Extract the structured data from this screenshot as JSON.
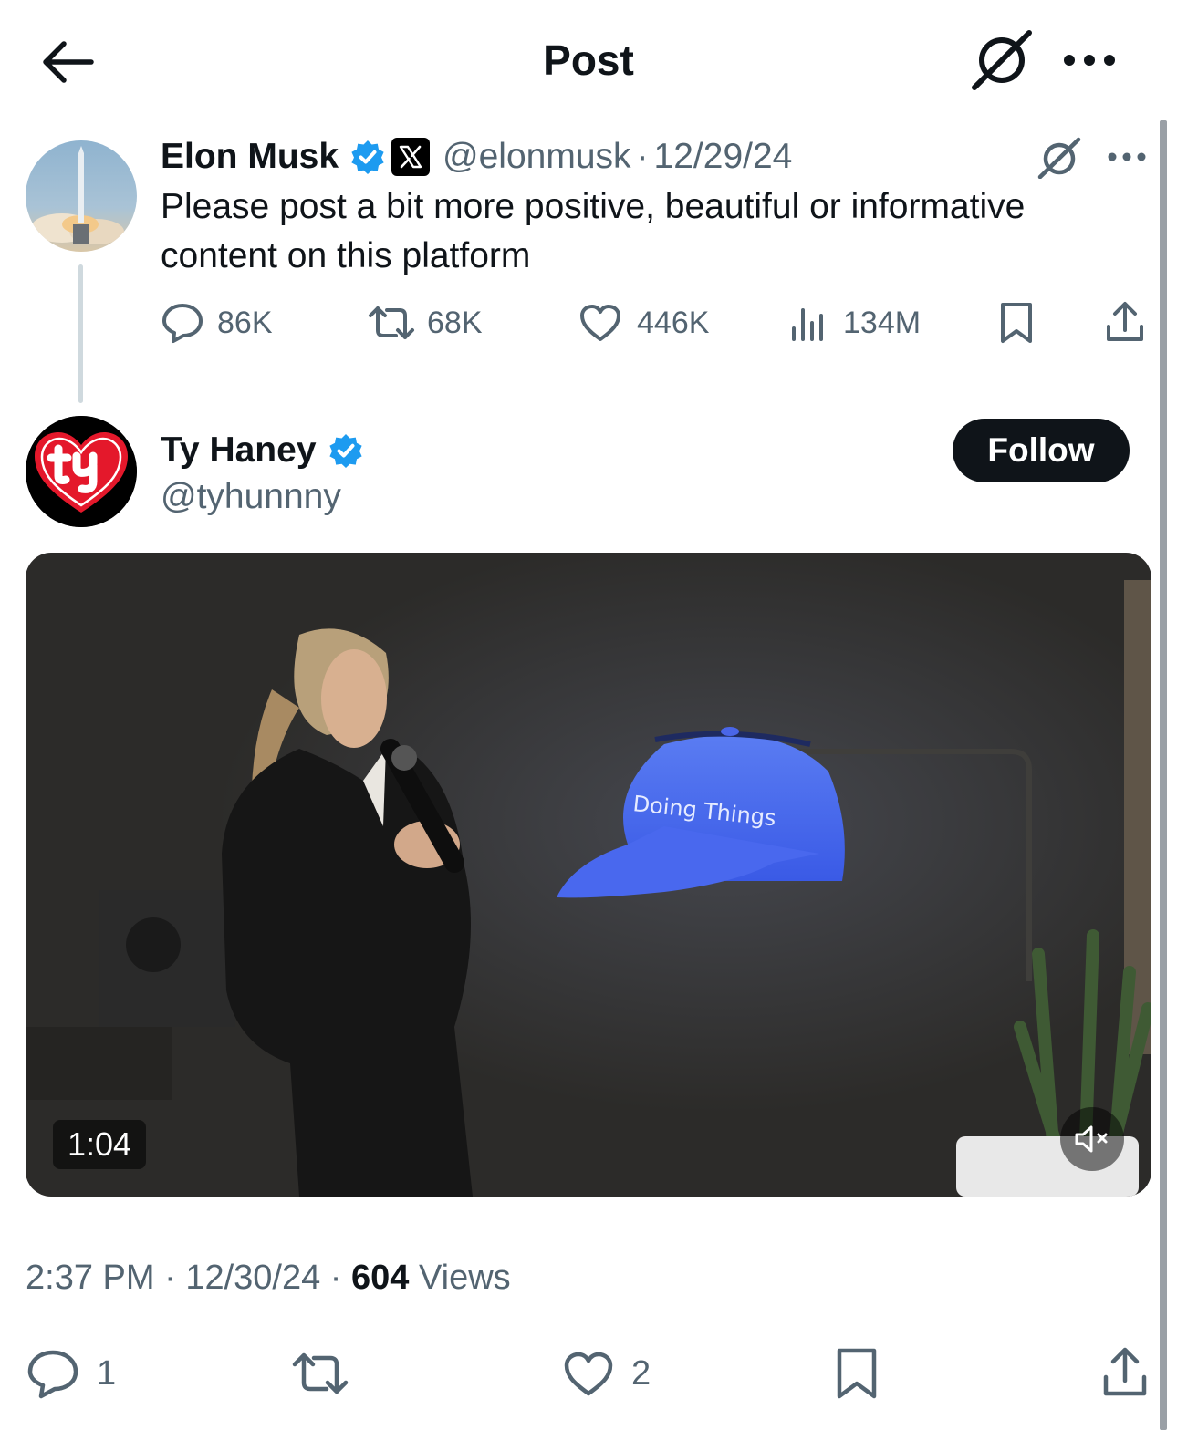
{
  "header": {
    "title": "Post",
    "back_icon": "arrow-left-icon",
    "grok_icon": "grok-icon",
    "more_icon": "more-horizontal-icon"
  },
  "quoted_post": {
    "author_name": "Elon Musk",
    "verified": true,
    "affiliate_badge": "X",
    "handle": "@elonmusk",
    "separator": "·",
    "date": "12/29/24",
    "text": "Please post a bit more positive, beautiful or informative content on this platform",
    "stats": {
      "replies": "86K",
      "reposts": "68K",
      "likes": "446K",
      "views": "134M"
    }
  },
  "main_post": {
    "author_name": "Ty Haney",
    "verified": true,
    "handle": "@tyhunnny",
    "follow_label": "Follow",
    "video": {
      "duration": "1:04",
      "overlay_text": "Doing Things",
      "muted": true
    },
    "time": "2:37 PM",
    "separator": "·",
    "date": "12/30/24",
    "views_count": "604",
    "views_label": "Views",
    "stats": {
      "replies": "1",
      "likes": "2"
    }
  },
  "colors": {
    "text_primary": "#0f1419",
    "text_secondary": "#536471",
    "verified_blue": "#1d9bf0",
    "button_dark": "#0f1419"
  }
}
